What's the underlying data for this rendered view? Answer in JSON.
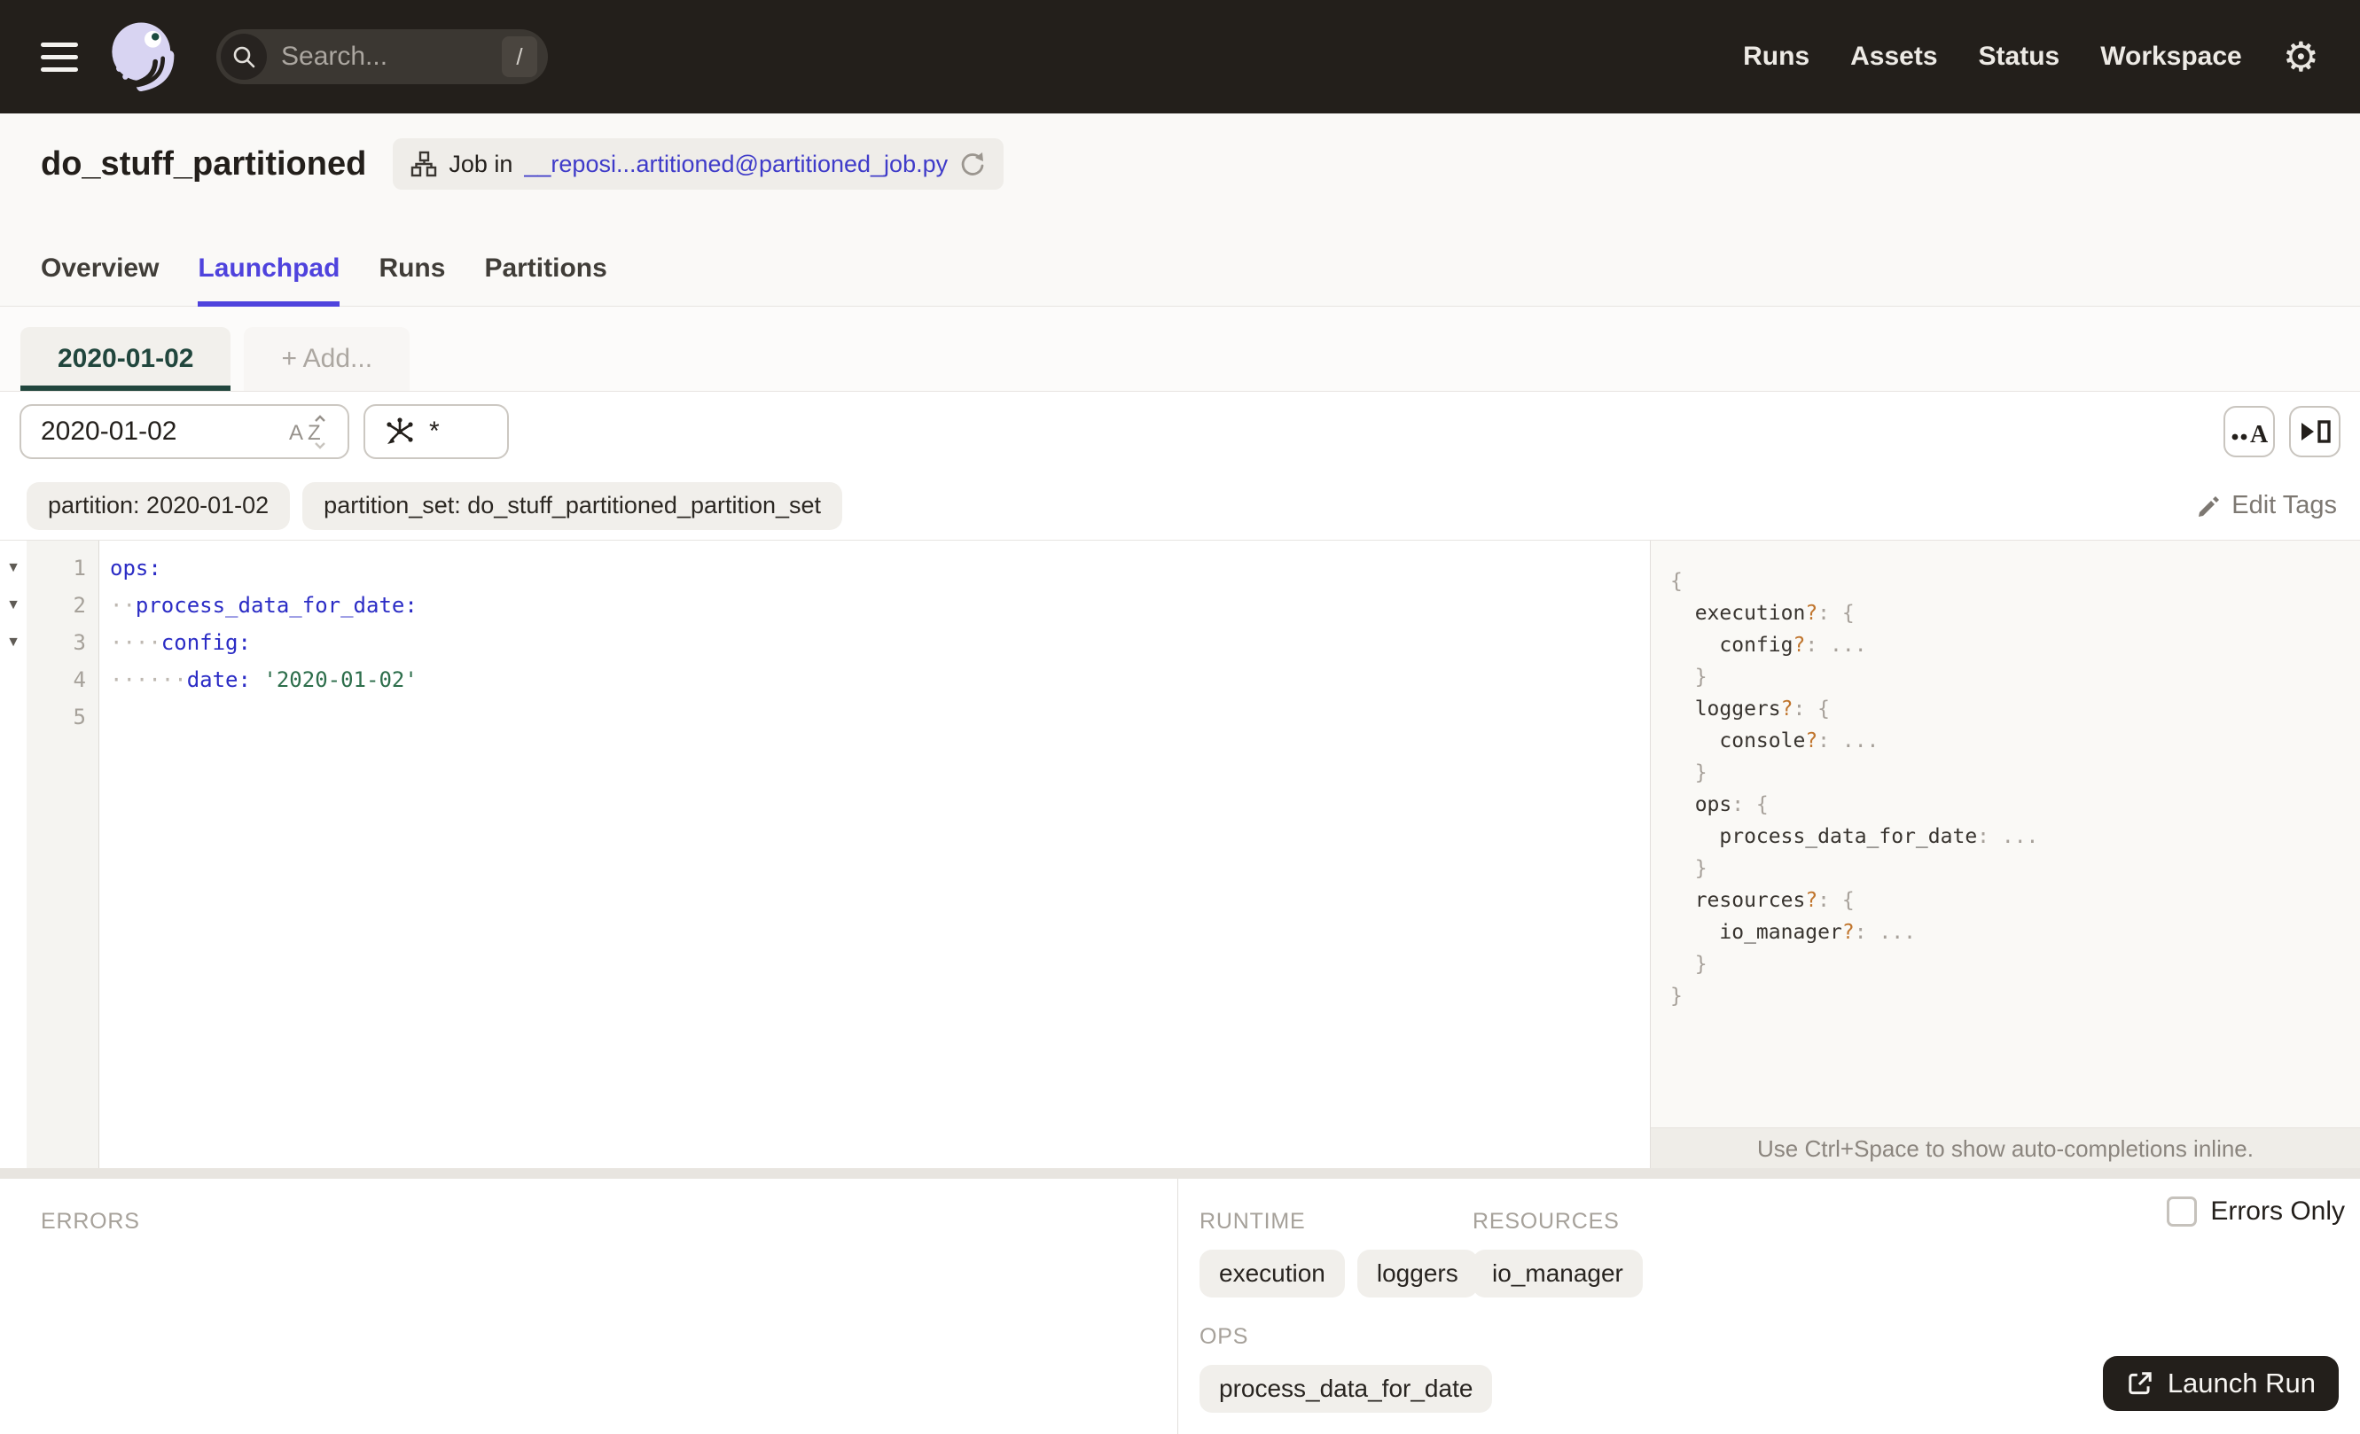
{
  "colors": {
    "dark": "#231F1B",
    "accent": "#4F43DD",
    "green": "#21463D",
    "link": "#3F3BC9",
    "key": "#2B2CC5",
    "string": "#2D6E4B",
    "optional": "#C0752D"
  },
  "icons": {
    "gear": "⚙",
    "fold": "▼"
  },
  "nav": {
    "search_placeholder": "Search...",
    "search_shortcut": "/",
    "links": [
      "Runs",
      "Assets",
      "Status",
      "Workspace"
    ]
  },
  "header": {
    "title": "do_stuff_partitioned",
    "badge": {
      "prefix": "Job in",
      "link": "__reposi...artitioned@partitioned_job.py"
    },
    "tabs": [
      {
        "label": "Overview",
        "active": false
      },
      {
        "label": "Launchpad",
        "active": true
      },
      {
        "label": "Runs",
        "active": false
      },
      {
        "label": "Partitions",
        "active": false
      }
    ]
  },
  "launchpad": {
    "config_tabs": [
      {
        "label": "2020-01-02",
        "active": true
      },
      {
        "label": "+ Add...",
        "active": false
      }
    ],
    "partition_input": "2020-01-02",
    "op_selection_value": "*",
    "tags": [
      "partition: 2020-01-02",
      "partition_set: do_stuff_partitioned_partition_set"
    ],
    "edit_tags_label": "Edit Tags",
    "editor": {
      "lines": [
        {
          "num": 1,
          "fold": true,
          "toks": [
            [
              "k",
              "ops:"
            ]
          ]
        },
        {
          "num": 2,
          "fold": true,
          "toks": [
            [
              "w",
              "··"
            ],
            [
              "k",
              "process_data_for_date:"
            ]
          ]
        },
        {
          "num": 3,
          "fold": true,
          "toks": [
            [
              "w",
              "····"
            ],
            [
              "k",
              "config:"
            ]
          ]
        },
        {
          "num": 4,
          "fold": false,
          "toks": [
            [
              "w",
              "······"
            ],
            [
              "k",
              "date:"
            ],
            [
              "t",
              " "
            ],
            [
              "s",
              "'2020-01-02'"
            ]
          ]
        },
        {
          "num": 5,
          "fold": false,
          "toks": []
        }
      ]
    },
    "schema_lines": [
      {
        "ind": 0,
        "toks": [
          [
            "p",
            "{"
          ]
        ]
      },
      {
        "ind": 1,
        "toks": [
          [
            "n",
            "execution"
          ],
          [
            "q",
            "?"
          ],
          [
            "p",
            ": {"
          ]
        ]
      },
      {
        "ind": 2,
        "toks": [
          [
            "n",
            "config"
          ],
          [
            "q",
            "?"
          ],
          [
            "p",
            ": ..."
          ]
        ]
      },
      {
        "ind": 1,
        "toks": [
          [
            "p",
            "}"
          ]
        ]
      },
      {
        "ind": 1,
        "toks": [
          [
            "n",
            "loggers"
          ],
          [
            "q",
            "?"
          ],
          [
            "p",
            ": {"
          ]
        ]
      },
      {
        "ind": 2,
        "toks": [
          [
            "n",
            "console"
          ],
          [
            "q",
            "?"
          ],
          [
            "p",
            ": ..."
          ]
        ]
      },
      {
        "ind": 1,
        "toks": [
          [
            "p",
            "}"
          ]
        ]
      },
      {
        "ind": 1,
        "toks": [
          [
            "n",
            "ops"
          ],
          [
            "p",
            ": {"
          ]
        ]
      },
      {
        "ind": 2,
        "toks": [
          [
            "n",
            "process_data_for_date"
          ],
          [
            "p",
            ": ..."
          ]
        ]
      },
      {
        "ind": 1,
        "toks": [
          [
            "p",
            "}"
          ]
        ]
      },
      {
        "ind": 1,
        "toks": [
          [
            "n",
            "resources"
          ],
          [
            "q",
            "?"
          ],
          [
            "p",
            ": {"
          ]
        ]
      },
      {
        "ind": 2,
        "toks": [
          [
            "n",
            "io_manager"
          ],
          [
            "q",
            "?"
          ],
          [
            "p",
            ": ..."
          ]
        ]
      },
      {
        "ind": 1,
        "toks": [
          [
            "p",
            "}"
          ]
        ]
      },
      {
        "ind": 0,
        "toks": [
          [
            "p",
            "}"
          ]
        ]
      }
    ],
    "hint": "Use Ctrl+Space to show auto-completions inline."
  },
  "bottom": {
    "errors_label": "ERRORS",
    "errors_only_label": "Errors Only",
    "sections": [
      {
        "title": "RUNTIME",
        "chips": [
          "execution",
          "loggers"
        ]
      },
      {
        "title": "RESOURCES",
        "chips": [
          "io_manager"
        ]
      },
      {
        "title": "OPS",
        "chips": [
          "process_data_for_date"
        ]
      }
    ],
    "launch_button": "Launch Run"
  }
}
